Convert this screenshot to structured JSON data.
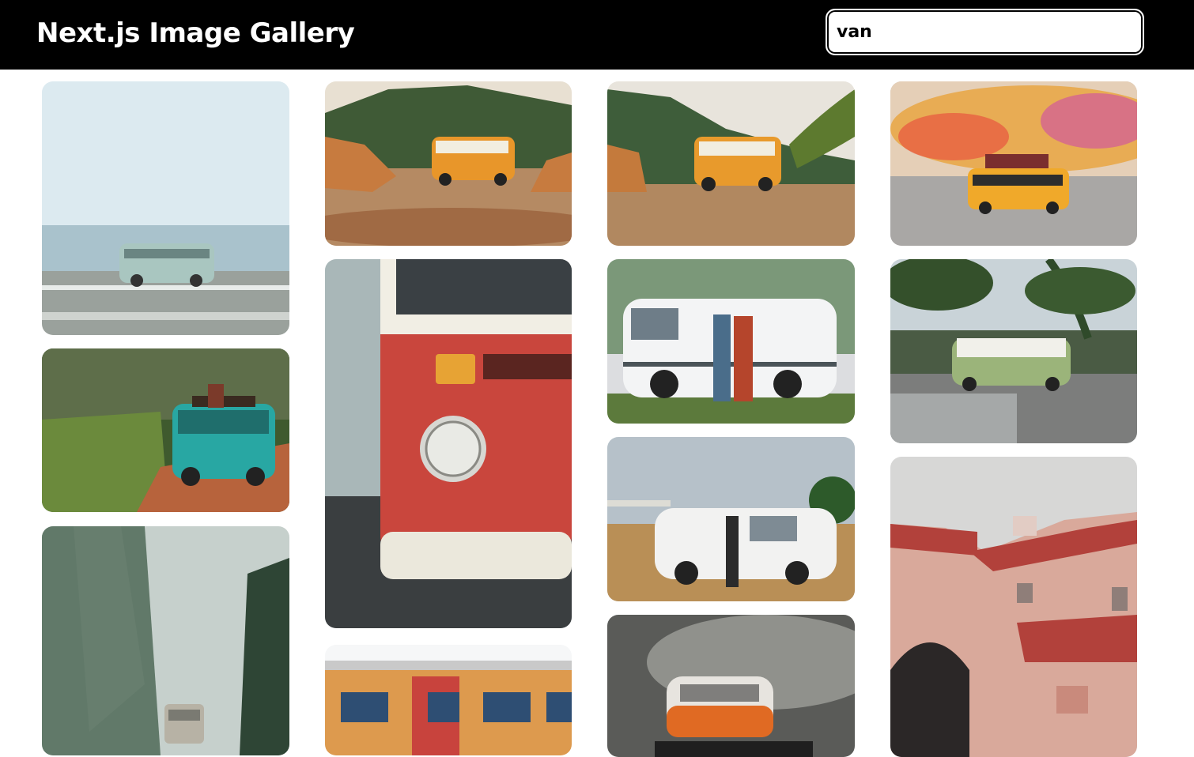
{
  "header": {
    "title": "Next.js Image Gallery"
  },
  "search": {
    "value": "van",
    "placeholder": ""
  },
  "gallery": {
    "items": [
      {
        "subject": "pale-green van parked on a seaside road"
      },
      {
        "subject": "teal vintage van loaded with luggage on a dirt road"
      },
      {
        "subject": "foggy forest road with a van"
      },
      {
        "subject": "orange vintage van on rocky ground with hills"
      },
      {
        "subject": "close-up of a red van front headlight"
      },
      {
        "subject": "red and yellow building facade"
      },
      {
        "subject": "orange vintage van on rocky ground near a plant"
      },
      {
        "subject": "couple leaning against a white van"
      },
      {
        "subject": "man standing by a white van in a wheat field"
      },
      {
        "subject": "orange toy van on a blurred background"
      },
      {
        "subject": "yellow toy taxi van on pavement"
      },
      {
        "subject": "green vintage van under palm trees"
      },
      {
        "subject": "pink building with red roof and archway"
      }
    ]
  }
}
